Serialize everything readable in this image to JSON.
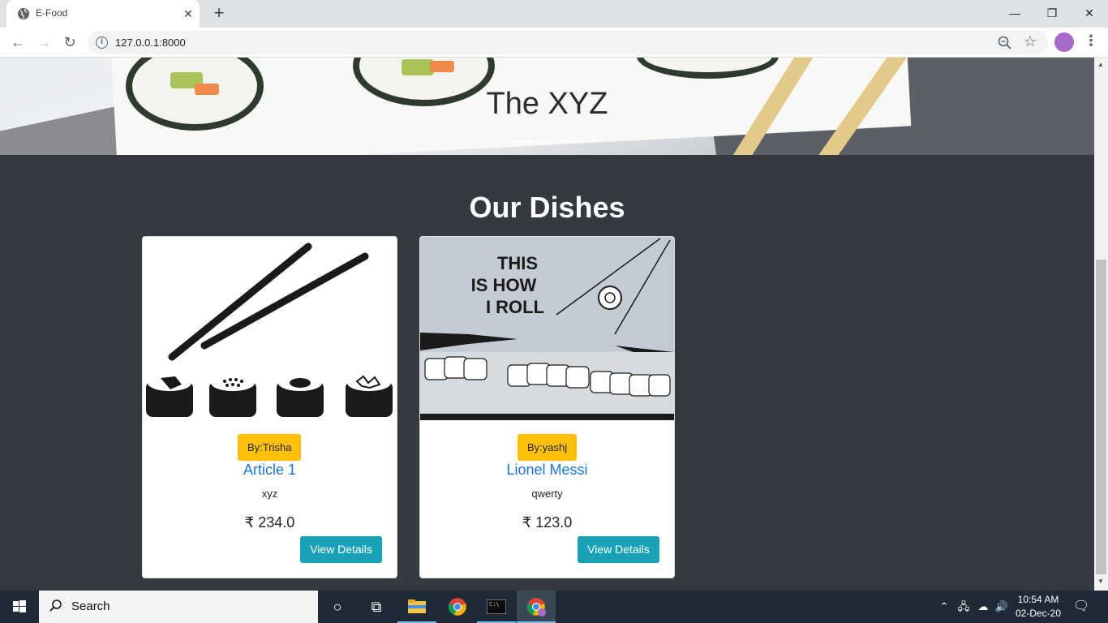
{
  "browser": {
    "tab_title": "E-Food",
    "url": "127.0.0.1:8000",
    "new_tab": "+",
    "window_controls": {
      "minimize": "—",
      "restore": "❐",
      "close": "✕"
    }
  },
  "hero": {
    "caption": "The XYZ",
    "slides": 3,
    "active_slide": 1
  },
  "section": {
    "title": "Our Dishes"
  },
  "dishes": [
    {
      "author": "By:Trisha",
      "title": "Article 1",
      "desc": "xyz",
      "price": "₹ 234.0",
      "button": "View Details",
      "image": "chopsticks-sushi-icon"
    },
    {
      "author": "By:yashj",
      "title": "Lionel Messi",
      "desc": "qwerty",
      "price": "₹ 123.0",
      "button": "View Details",
      "image": "this-is-how-i-roll-illustration",
      "image_text": [
        "THIS",
        "IS HOW",
        "I ROLL"
      ]
    }
  ],
  "taskbar": {
    "search_placeholder": "Search",
    "time": "10:54 AM",
    "date": "02-Dec-20",
    "colors": {
      "bar": "#1e2b36",
      "accent": "#76b9ed"
    }
  },
  "colors": {
    "page_bg": "#343a40",
    "badge": "#ffc107",
    "title_link": "#1b76d3",
    "button": "#17a2b8"
  }
}
